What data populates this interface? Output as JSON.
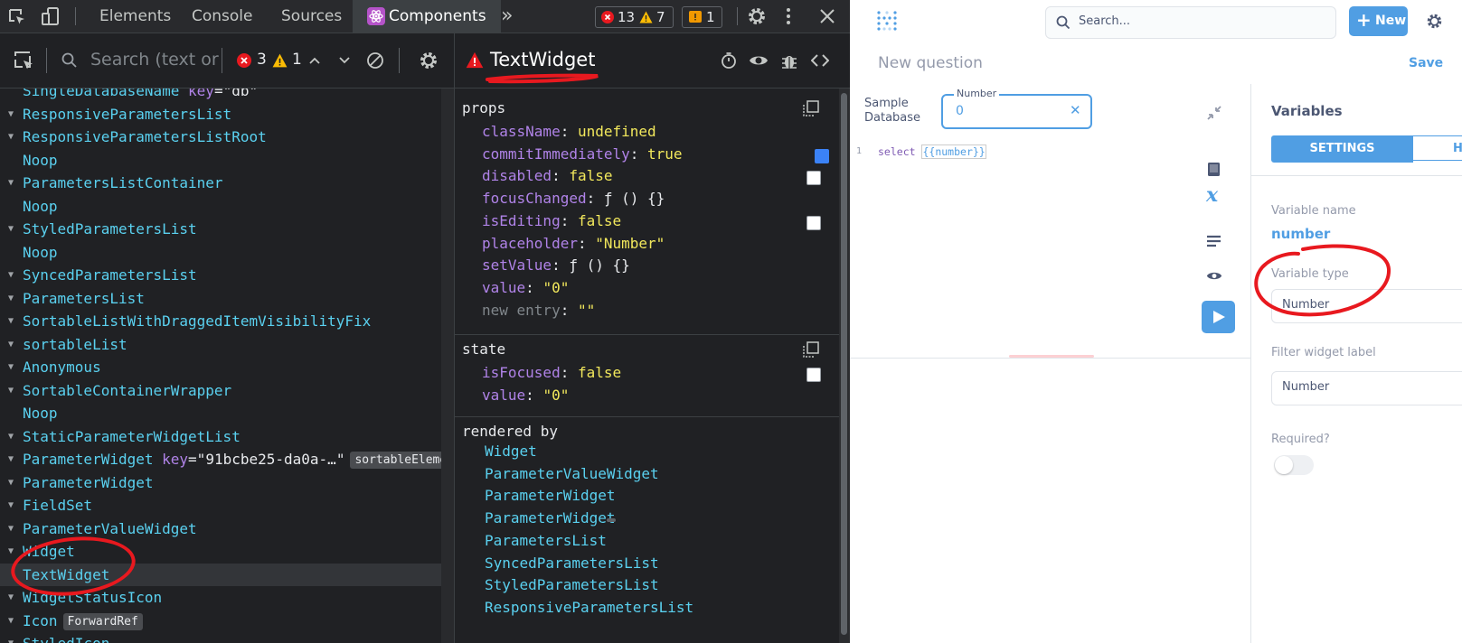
{
  "devtools": {
    "top_tabs": [
      "Elements",
      "Console",
      "Sources",
      "Components"
    ],
    "errors": "13",
    "warnings": "7",
    "issues": "1",
    "search_placeholder": "Search (text or",
    "comp_errors": "3",
    "comp_warnings": "1",
    "selected_component": "TextWidget",
    "tree": [
      {
        "name": "SingleDatabaseName",
        "key": "db",
        "arrow": "none"
      },
      {
        "name": "ResponsiveParametersList",
        "arrow": "down"
      },
      {
        "name": "ResponsiveParametersListRoot",
        "arrow": "down"
      },
      {
        "name": "Noop",
        "arrow": "none"
      },
      {
        "name": "ParametersListContainer",
        "arrow": "down"
      },
      {
        "name": "Noop",
        "arrow": "none"
      },
      {
        "name": "StyledParametersList",
        "arrow": "down"
      },
      {
        "name": "Noop",
        "arrow": "none"
      },
      {
        "name": "SyncedParametersList",
        "arrow": "down"
      },
      {
        "name": "ParametersList",
        "arrow": "down"
      },
      {
        "name": "SortableListWithDraggedItemVisibilityFix",
        "arrow": "down"
      },
      {
        "name": "sortableList",
        "arrow": "down"
      },
      {
        "name": "Anonymous",
        "arrow": "down"
      },
      {
        "name": "SortableContainerWrapper",
        "arrow": "down"
      },
      {
        "name": "Noop",
        "arrow": "none"
      },
      {
        "name": "StaticParameterWidgetList",
        "arrow": "down"
      },
      {
        "name": "ParameterWidget",
        "key": "91bcbe25-da0a-…",
        "chip": "sortableElemen",
        "arrow": "down"
      },
      {
        "name": "ParameterWidget",
        "arrow": "down"
      },
      {
        "name": "FieldSet",
        "arrow": "down"
      },
      {
        "name": "ParameterValueWidget",
        "arrow": "down"
      },
      {
        "name": "Widget",
        "arrow": "down"
      },
      {
        "name": "TextWidget",
        "arrow": "none",
        "selected": true
      },
      {
        "name": "WidgetStatusIcon",
        "arrow": "down"
      },
      {
        "name": "Icon",
        "chip": "ForwardRef",
        "arrow": "down"
      },
      {
        "name": "StyledIcon",
        "arrow": "down"
      }
    ],
    "props_title": "props",
    "props": [
      {
        "key": "className",
        "value": "undefined",
        "type": "undef"
      },
      {
        "key": "commitImmediately",
        "value": "true",
        "type": "bool",
        "check": "checked"
      },
      {
        "key": "disabled",
        "value": "false",
        "type": "bool",
        "check": "unchecked"
      },
      {
        "key": "focusChanged",
        "value": "ƒ () {}",
        "type": "fn"
      },
      {
        "key": "isEditing",
        "value": "false",
        "type": "bool",
        "check": "unchecked"
      },
      {
        "key": "placeholder",
        "value": "\"Number\"",
        "type": "str"
      },
      {
        "key": "setValue",
        "value": "ƒ () {}",
        "type": "fn"
      },
      {
        "key": "value",
        "value": "\"0\"",
        "type": "str"
      },
      {
        "key": "new entry",
        "value": "\"\"",
        "type": "new"
      }
    ],
    "state_title": "state",
    "state": [
      {
        "key": "isFocused",
        "value": "false",
        "type": "bool",
        "check": "unchecked"
      },
      {
        "key": "value",
        "value": "\"0\"",
        "type": "str"
      }
    ],
    "rendered_by_title": "rendered by",
    "rendered_by": [
      "Widget",
      "ParameterValueWidget",
      "ParameterWidget",
      "ParameterWidget",
      "ParametersList",
      "SyncedParametersList",
      "StyledParametersList",
      "ResponsiveParametersList"
    ]
  },
  "metabase": {
    "search_placeholder": "Search...",
    "new_label": "New",
    "title": "New question",
    "save_label": "Save",
    "database_label_1": "Sample",
    "database_label_2": "Database",
    "param_label": "Number",
    "param_value": "0",
    "line_number": "1",
    "sql_keyword": "select",
    "sql_var": "{{number}}",
    "variables_title": "Variables",
    "settings_tab": "SETTINGS",
    "help_tab_partial": "H",
    "variable_name_label": "Variable name",
    "variable_name": "number",
    "variable_type_label": "Variable type",
    "variable_type": "Number",
    "filter_label_title": "Filter widget label",
    "filter_label": "Number",
    "required_label": "Required?",
    "accent": "#509ee3"
  }
}
